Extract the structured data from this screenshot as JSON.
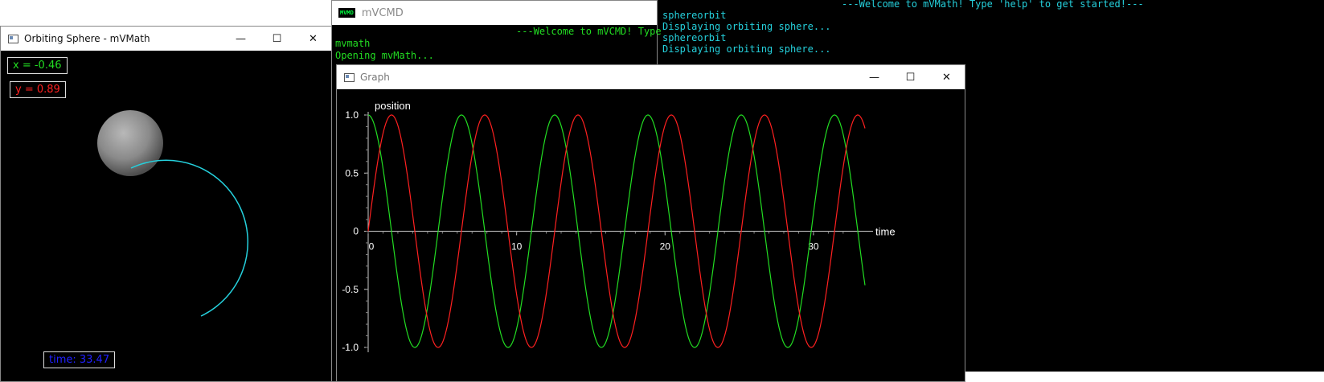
{
  "console_bg": {
    "welcome": "---Welcome to mVMath! Type 'help' to get started!---",
    "lines": [
      "sphereorbit",
      "Displaying orbiting sphere...",
      "sphereorbit",
      "Displaying orbiting sphere..."
    ]
  },
  "mvcmd": {
    "title": "mVCMD",
    "logo": "MVMD",
    "welcome": "---Welcome to mVCMD! Type",
    "lines": [
      "mvmath",
      "Opening mvMath..."
    ]
  },
  "orbit_window": {
    "title": "Orbiting Sphere - mVMath",
    "x_label": "x = -0.46",
    "y_label": "y = 0.89",
    "time_label": "time: 33.47",
    "colors": {
      "x": "#22dd22",
      "y": "#ff2020",
      "time": "#2020ff",
      "path": "#25d0dc"
    }
  },
  "graph_window": {
    "title": "Graph",
    "controls": {
      "minimize": "—",
      "maximize": "☐",
      "close": "✕"
    }
  },
  "chart_data": {
    "type": "line",
    "title": "position",
    "xlabel": "time",
    "ylabel": "",
    "xlim": [
      0,
      33.47
    ],
    "ylim": [
      -1,
      1
    ],
    "x_ticks": [
      "0",
      "10",
      "20",
      "30"
    ],
    "x_tick_values": [
      0,
      10,
      20,
      30
    ],
    "y_ticks": [
      "1.0",
      "0.5",
      "0",
      "-0.5",
      "-1.0"
    ],
    "y_tick_values": [
      1,
      0.5,
      0,
      -0.5,
      -1
    ],
    "series": [
      {
        "function": "cos(t)",
        "color": "#22dd22"
      },
      {
        "function": "sin(t)",
        "color": "#ff2020"
      }
    ],
    "grid": false
  }
}
